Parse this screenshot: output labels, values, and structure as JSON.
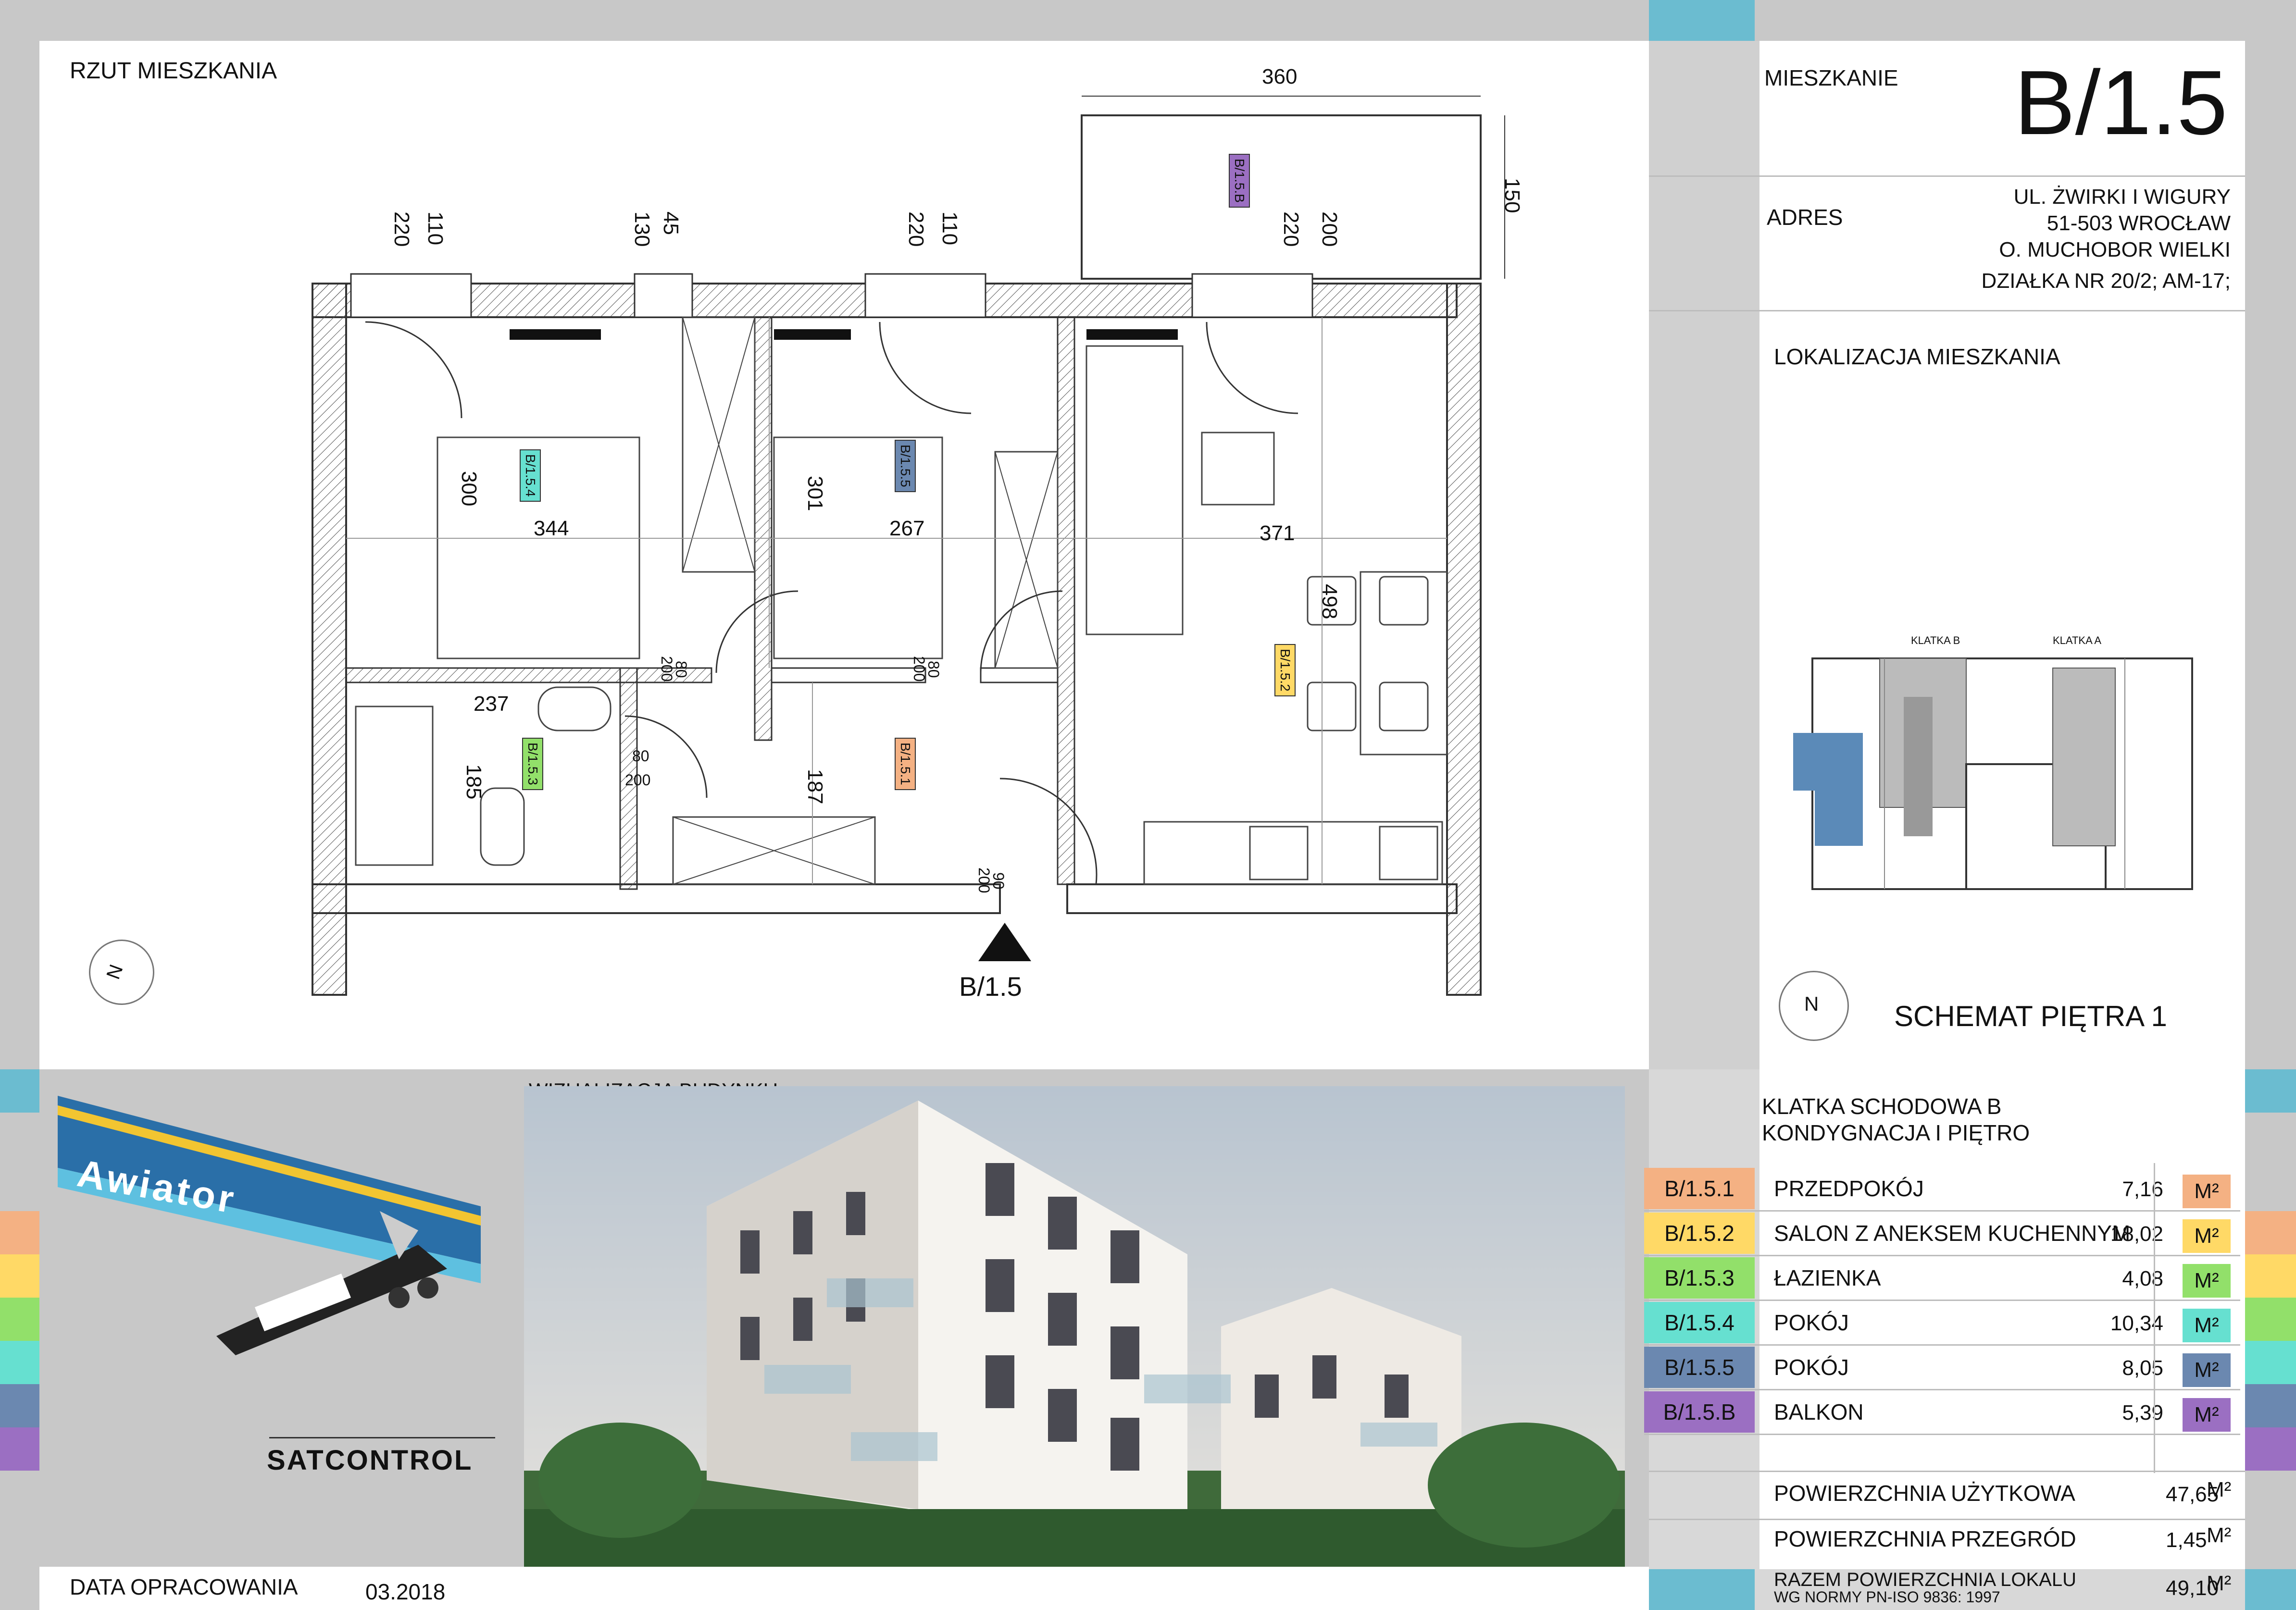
{
  "plan": {
    "title": "RZUT MIESZKANIA",
    "flat_marker": "B/1.5",
    "dimensions": {
      "balcony_width": "360",
      "balcony_depth": "150",
      "w1a": "220",
      "w1b": "110",
      "w2a": "130",
      "w2b": "45",
      "w3a": "220",
      "w3b": "110",
      "w4a": "220",
      "w4b": "200",
      "room4_h": "300",
      "room4_w": "344",
      "room5_h": "301",
      "room5_w": "267",
      "salon_w": "371",
      "salon_h": "498",
      "bath_w": "237",
      "bath_h": "185",
      "hall_h": "187",
      "door1_a": "80",
      "door1_b": "200",
      "door2_a": "80",
      "door2_b": "200",
      "door3_a": "80",
      "door3_b": "200",
      "door4_a": "90",
      "door4_b": "200"
    },
    "room_tags": {
      "balcony": "B/1.5.B",
      "room4": "B/1.5.4",
      "room5": "B/1.5.5",
      "salon": "B/1.5.2",
      "bath": "B/1.5.3",
      "hall": "B/1.5.1"
    },
    "north_label": "N"
  },
  "header": {
    "flat_label": "MIESZKANIE",
    "flat_number": "B/1.5",
    "address_label": "ADRES",
    "address_lines": [
      "UL. ŻWIRKI I WIGURY",
      "51-503 WROCŁAW",
      "O. MUCHOBOR WIELKI",
      "DZIAŁKA NR 20/2; AM-17;"
    ]
  },
  "location": {
    "title": "LOKALIZACJA MIESZKANIA",
    "klatka_b": "KLATKA B",
    "klatka_a": "KLATKA A",
    "north_label": "N",
    "schema_title": "SCHEMAT PIĘTRA 1"
  },
  "logo": {
    "brand": "Awiator",
    "company": "SATCONTROL"
  },
  "visualization": {
    "title": "WIZUALIZACJA  BUDYNKU"
  },
  "footer": {
    "date_label": "DATA OPRACOWANIA",
    "date_value": "03.2018"
  },
  "summary": {
    "line1": "KLATKA SCHODOWA B",
    "line2": "KONDYGNACJA  I PIĘTRO",
    "unit": "M²",
    "rooms": [
      {
        "code": "B/1.5.1",
        "name": "PRZEDPOKÓJ",
        "area": "7,16",
        "color": "#f4b183"
      },
      {
        "code": "B/1.5.2",
        "name": "SALON Z ANEKSEM KUCHENNYM",
        "area": "18,02",
        "color": "#ffd966"
      },
      {
        "code": "B/1.5.3",
        "name": "ŁAZIENKA",
        "area": "4,08",
        "color": "#92e06a"
      },
      {
        "code": "B/1.5.4",
        "name": "POKÓJ",
        "area": "10,34",
        "color": "#66e0d0"
      },
      {
        "code": "B/1.5.5",
        "name": "POKÓJ",
        "area": "8,05",
        "color": "#6b88b0"
      },
      {
        "code": "B/1.5.B",
        "name": "BALKON",
        "area": "5,39",
        "color": "#9b6fc2"
      }
    ],
    "totals": [
      {
        "name": "POWIERZCHNIA UŻYTKOWA",
        "area": "47,65"
      },
      {
        "name": "POWIERZCHNIA PRZEGRÓD",
        "area": "1,45"
      }
    ],
    "total_line1": "RAZEM POWIERZCHNIA LOKALU",
    "total_line2": "WG NORMY PN-ISO 9836: 1997",
    "total_area": "49,10"
  }
}
